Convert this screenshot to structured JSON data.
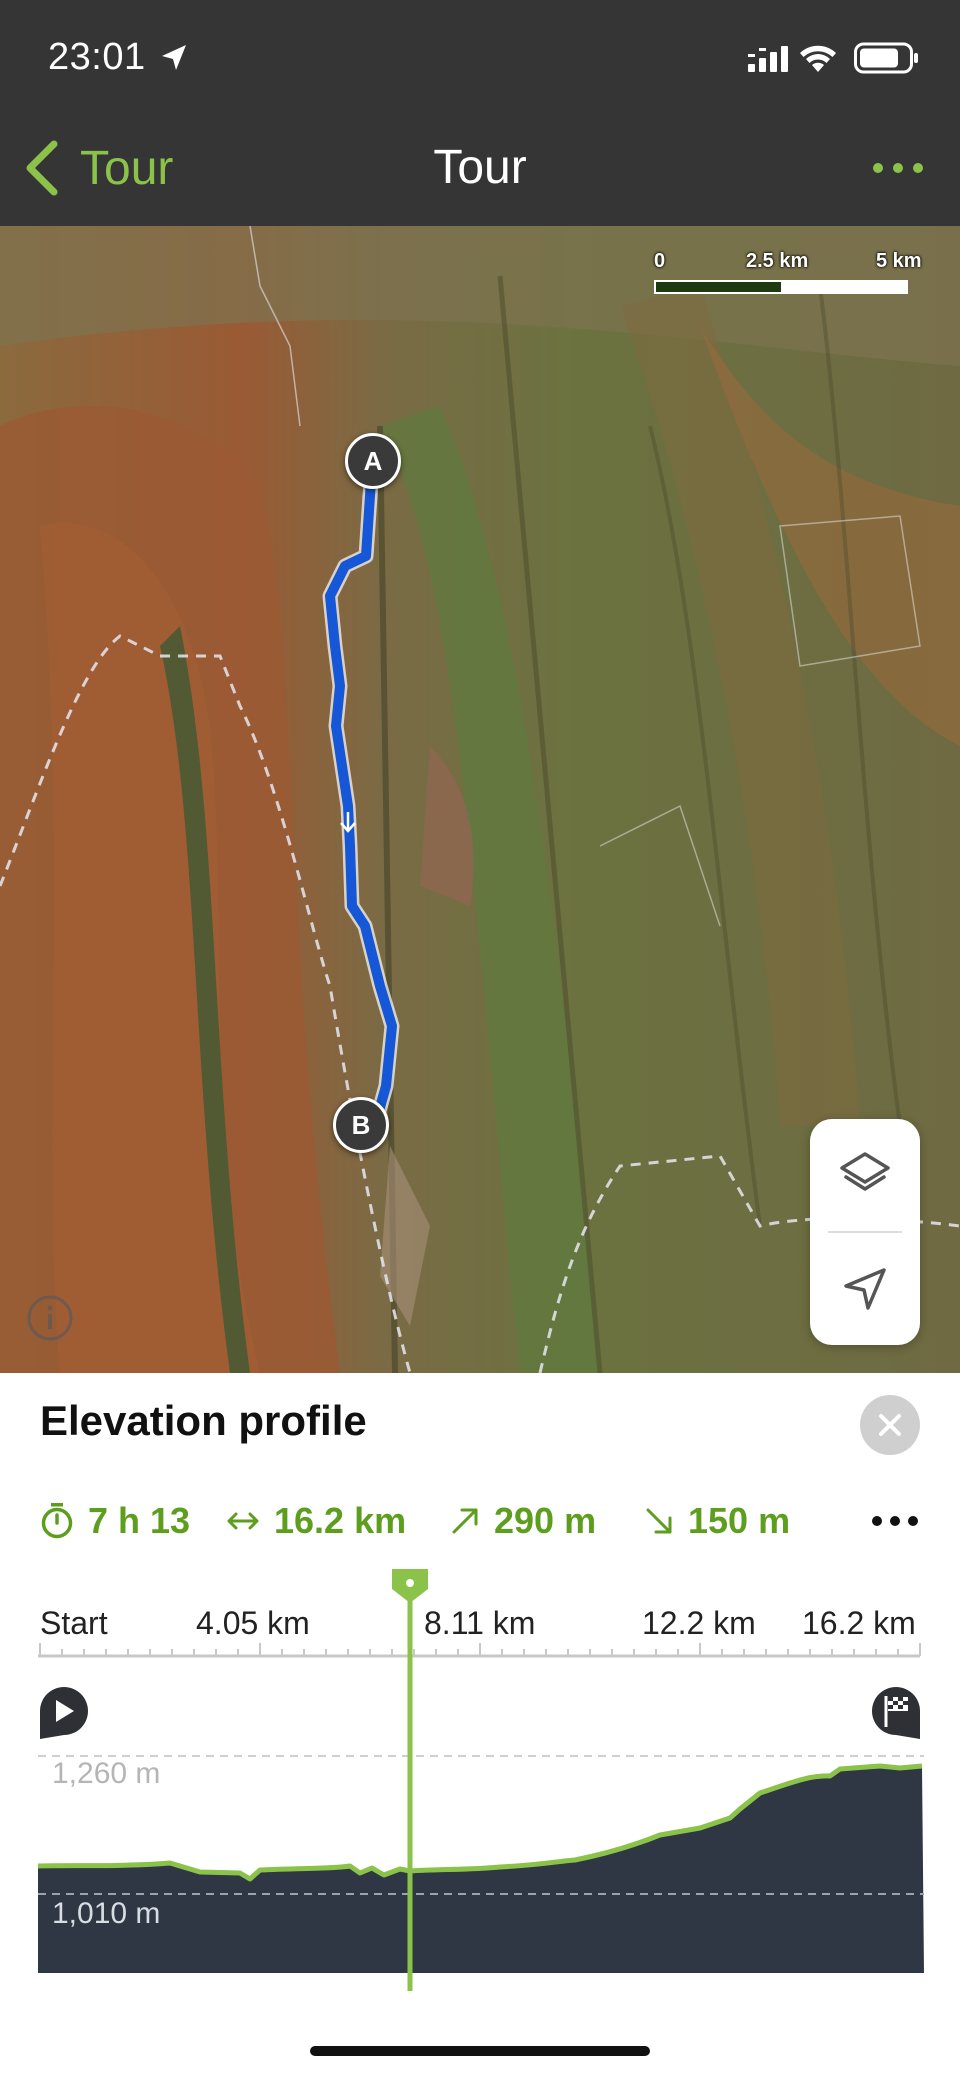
{
  "status_bar": {
    "time": "23:01"
  },
  "nav": {
    "back_label": "Tour",
    "title": "Tour"
  },
  "map": {
    "scale": {
      "labels": [
        "0",
        "2.5 km",
        "5 km"
      ]
    },
    "start_marker": "A",
    "end_marker": "B"
  },
  "sheet": {
    "title": "Elevation profile",
    "stats": {
      "duration": "7 h 13",
      "distance": "16.2 km",
      "ascent": "290 m",
      "descent": "150 m"
    },
    "distance_axis": [
      "Start",
      "4.05 km",
      "8.11 km",
      "12.2 km",
      "16.2 km"
    ],
    "elevation_labels": {
      "upper": "1,260 m",
      "lower": "1,010 m"
    },
    "colors": {
      "accent": "#8bc34a",
      "stats_green": "#5e9e1f",
      "profile_fill": "#2e3743"
    }
  },
  "icons": {
    "location-arrow": "location-arrow-icon",
    "signal": "cellular-signal-icon",
    "wifi": "wifi-icon",
    "battery": "battery-icon",
    "back": "chevron-left-icon",
    "more": "more-dots-icon",
    "layers": "layers-icon",
    "locate": "navigation-arrow-icon",
    "info": "info-icon",
    "close": "close-icon",
    "timer": "stopwatch-icon",
    "distance": "horizontal-arrows-icon",
    "ascent": "arrow-up-right-icon",
    "descent": "arrow-down-right-icon",
    "start_flag": "play-pin-icon",
    "finish_flag": "checkered-flag-pin-icon"
  }
}
